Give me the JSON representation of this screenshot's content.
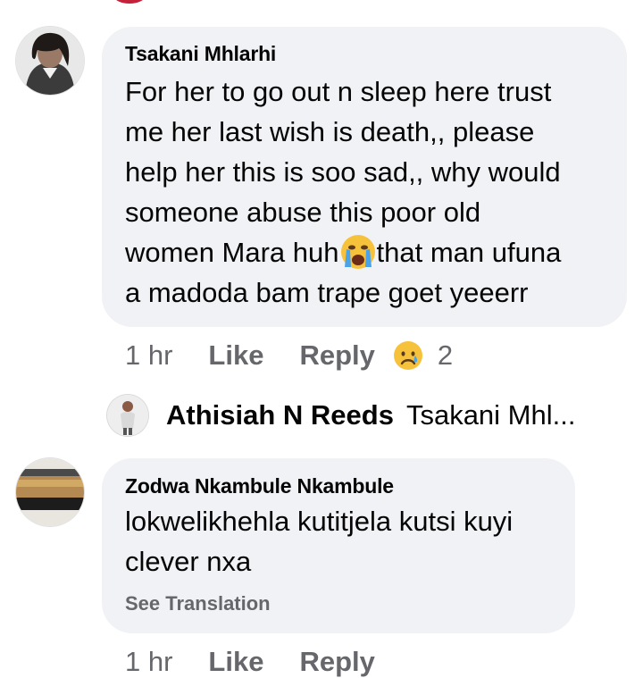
{
  "comments": [
    {
      "author": "Tsakani Mhlarhi",
      "text_lines": [
        "For her to go out n sleep here trust",
        "me her last wish is death,, please",
        "help her this is soo sad,, why would",
        "someone abuse this poor old",
        "women Mara huh",
        "that man ufuna",
        "a madoda bam trape goet yeeerr"
      ],
      "time": "1 hr",
      "like_label": "Like",
      "reply_label": "Reply",
      "reaction_count": "2",
      "reaction_icon": "sad-face-icon",
      "inline_emoji": "loudly-crying-face-icon"
    },
    {
      "author": "Zodwa Nkambule Nkambule",
      "text_lines": [
        "lokwelikhehla kutitjela kutsi kuyi",
        "clever nxa"
      ],
      "see_translation": "See Translation",
      "time": "1 hr",
      "like_label": "Like",
      "reply_label": "Reply"
    }
  ],
  "reply_preview": {
    "author": "Athisiah N Reeds",
    "text": "Tsakani Mhl..."
  },
  "colors": {
    "bubble": "#f0f2f5",
    "secondary_text": "#65676b",
    "primary_text": "#050505"
  }
}
